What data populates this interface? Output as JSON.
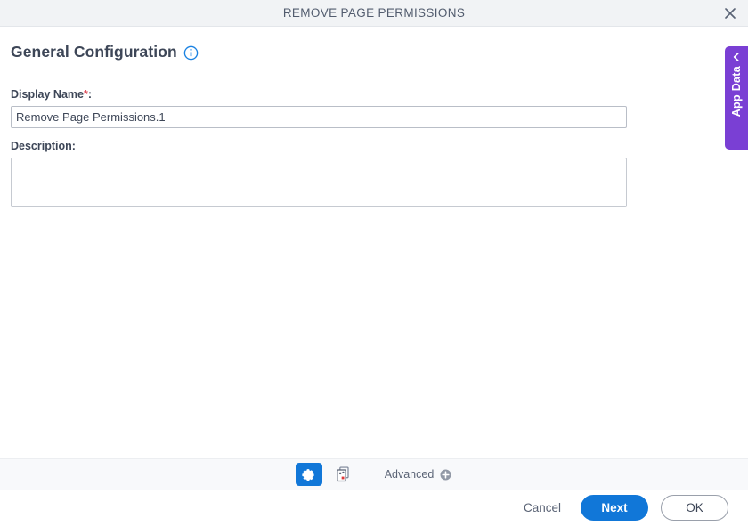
{
  "window": {
    "title": "REMOVE PAGE PERMISSIONS",
    "close_icon": "close-icon"
  },
  "section": {
    "title": "General Configuration",
    "info_icon": "info-icon"
  },
  "form": {
    "display_name": {
      "label": "Display Name",
      "required_marker": "*",
      "colon": ":",
      "value": "Remove Page Permissions.1"
    },
    "description": {
      "label": "Description:",
      "value": ""
    }
  },
  "app_data_tab": {
    "label": "App Data",
    "chevron_icon": "chevron-left-icon",
    "color": "#7a3fd4"
  },
  "toolbar": {
    "gear_icon": "gear-icon",
    "page_permissions_icon": "page-permissions-icon",
    "advanced_label": "Advanced",
    "advanced_add_icon": "plus-circle-icon",
    "active_color": "#1177d8"
  },
  "footer": {
    "cancel_label": "Cancel",
    "next_label": "Next",
    "ok_label": "OK",
    "primary_color": "#1177d8"
  }
}
